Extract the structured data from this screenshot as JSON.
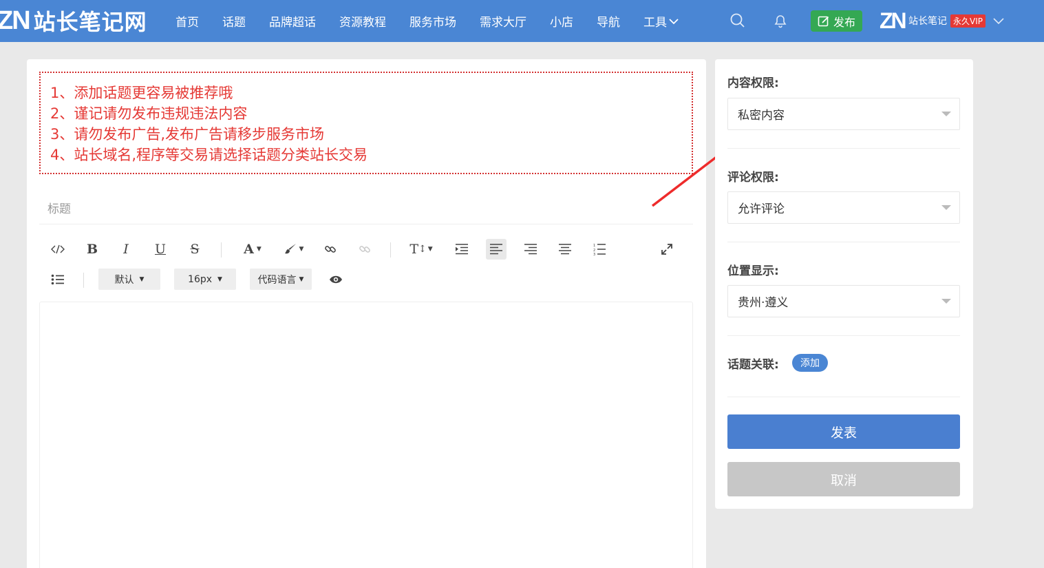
{
  "header": {
    "logo_mark": "ZN",
    "site_name": "站长笔记网",
    "nav": [
      "首页",
      "话题",
      "品牌超话",
      "资源教程",
      "服务市场",
      "需求大厅",
      "小店",
      "导航"
    ],
    "tools_label": "工具",
    "publish_label": "发布",
    "user_avatar": "ZN",
    "user_name": "站长笔记",
    "vip_badge": "永久VIP",
    "colors": {
      "bar": "#4a86d4",
      "publish": "#34a853",
      "vip": "#e53935"
    }
  },
  "notice": [
    "1、添加话题更容易被推荐哦",
    "2、谨记请勿发布违规违法内容",
    "3、请勿发布广告,发布广告请移步服务市场",
    "4、站长域名,程序等交易请选择话题分类站长交易"
  ],
  "title_placeholder": "标题",
  "toolbar": {
    "font_family": "默认",
    "font_size": "16px",
    "code_language": "代码语言",
    "bold": "B",
    "italic": "I",
    "underline": "U",
    "strike": "S",
    "font_color": "A",
    "heading": "T"
  },
  "sidebar": {
    "content_permission_label": "内容权限:",
    "content_permission_value": "私密内容",
    "comment_permission_label": "评论权限:",
    "comment_permission_value": "允许评论",
    "location_label": "位置显示:",
    "location_value": "贵州·遵义",
    "topic_label": "话题关联:",
    "topic_add": "添加",
    "submit": "发表",
    "cancel": "取消"
  }
}
